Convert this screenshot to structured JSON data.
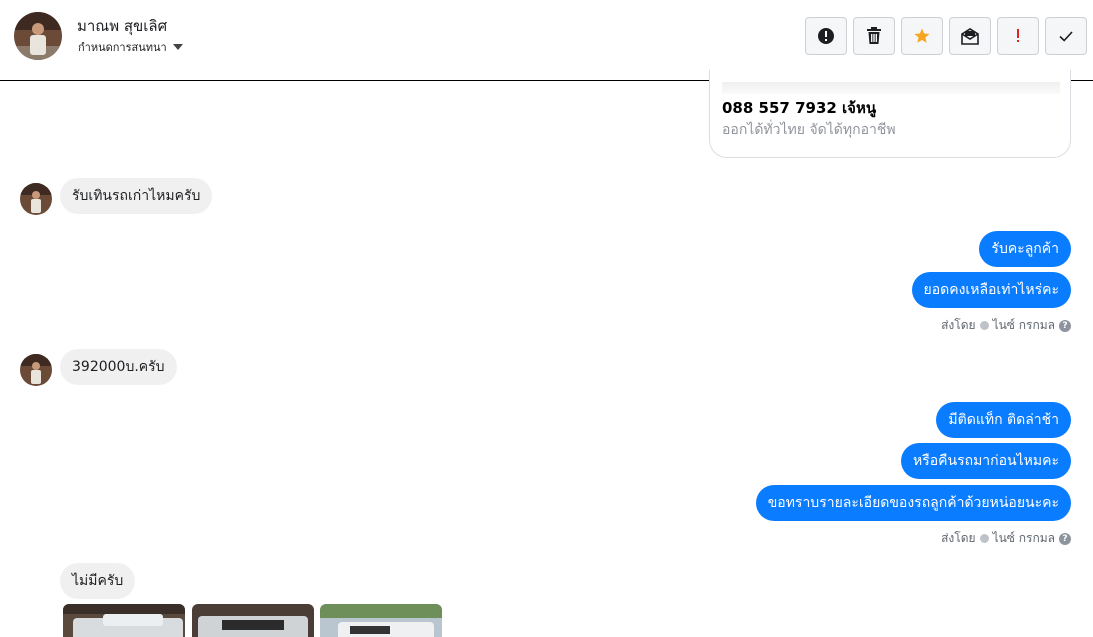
{
  "header": {
    "contact_name": "มาณพ สุขเลิศ",
    "subtitle": "กำหนดการสนทนา"
  },
  "toolbar": {
    "buttons": [
      {
        "icon": "exclamation-circle-icon"
      },
      {
        "icon": "trash-icon"
      },
      {
        "icon": "star-icon",
        "color": "#f5a623"
      },
      {
        "icon": "mark-unread-icon"
      },
      {
        "icon": "exclamation-icon",
        "color": "#e02424"
      },
      {
        "icon": "checkmark-icon"
      }
    ]
  },
  "card": {
    "phone": "088 557 7932 เจ้หนู",
    "description": "ออกได้ทั่วไทย จัดได้ทุกอาชีพ"
  },
  "messages": {
    "incoming_1": "รับเทินรถเก่าไหมครับ",
    "outgoing_1": [
      "รับคะลูกค้า",
      "ยอดคงเหลือเท่าไหร่คะ"
    ],
    "status_1": {
      "label": "ส่งโดย",
      "sender": "ไนซ์ กรกมล"
    },
    "incoming_2": "392000บ.ครับ",
    "outgoing_2": [
      "มีติดแท็ก ติดล่าช้า",
      "หรือคืนรถมาก่อนไหมคะ",
      "ขอทราบรายละเอียดของรถลูกค้าด้วยหน่อยนะคะ"
    ],
    "status_2": {
      "label": "ส่งโดย",
      "sender": "ไนซ์ กรกมล"
    },
    "incoming_3": "ไม่มีครับ"
  },
  "colors": {
    "outgoing_bubble": "#0a7cff",
    "incoming_bubble": "#f1f0f0"
  }
}
